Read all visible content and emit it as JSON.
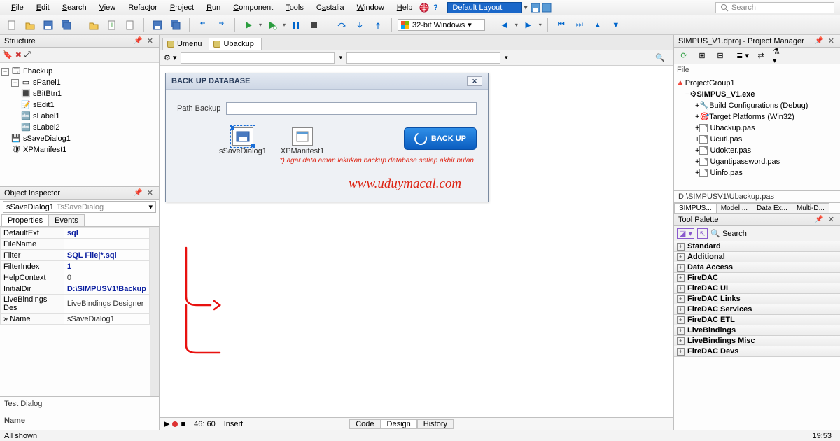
{
  "menu": {
    "items": [
      "File",
      "Edit",
      "Search",
      "View",
      "Refactor",
      "Project",
      "Run",
      "Component",
      "Tools",
      "Castalia",
      "Window",
      "Help"
    ],
    "layout": "Default Layout",
    "search_placeholder": "Search"
  },
  "toolbar": {
    "platform": "32-bit Windows"
  },
  "structure": {
    "title": "Structure",
    "root": "Fbackup",
    "panel": "sPanel1",
    "children": [
      "sBitBtn1",
      "sEdit1",
      "sLabel1",
      "sLabel2"
    ],
    "extra": [
      "sSaveDialog1",
      "XPManifest1"
    ]
  },
  "inspector": {
    "title": "Object Inspector",
    "component_name": "sSaveDialog1",
    "component_type": "TsSaveDialog",
    "tabs": [
      "Properties",
      "Events"
    ],
    "rows": [
      {
        "k": "DefaultExt",
        "v": "sql",
        "bold": true
      },
      {
        "k": "FileName",
        "v": "",
        "bold": true
      },
      {
        "k": "Filter",
        "v": "SQL File|*.sql",
        "bold": true
      },
      {
        "k": "FilterIndex",
        "v": "1",
        "bold": true
      },
      {
        "k": "HelpContext",
        "v": "0",
        "bold": false
      },
      {
        "k": "InitialDir",
        "v": "D:\\SIMPUSV1\\Backup",
        "bold": true
      },
      {
        "k": "LiveBindings Des",
        "v": "LiveBindings Designer",
        "bold": false
      },
      {
        "k": "Name",
        "v": "sSaveDialog1",
        "bold": false
      }
    ],
    "test_dialog": "Test Dialog",
    "name_label": "Name",
    "all_shown": "All shown"
  },
  "center": {
    "tabs": [
      {
        "label": "Umenu",
        "active": false
      },
      {
        "label": "Ubackup",
        "active": true
      }
    ],
    "form": {
      "title": "BACK UP DATABASE",
      "path_label": "Path Backup",
      "comp1": "sSaveDialog1",
      "comp2": "XPManifest1",
      "button": "BACK UP",
      "note": "*) agar data aman lakukan backup database setiap akhir bulan"
    },
    "watermark": "www.uduymacal.com",
    "status": {
      "cursor": "46: 60",
      "mode": "Insert",
      "tabs": [
        "Code",
        "Design",
        "History"
      ],
      "active_tab": "Design"
    }
  },
  "project": {
    "title_full": "SIMPUS_V1.dproj - Project Manager",
    "file_label": "File",
    "group": "ProjectGroup1",
    "exe": "SIMPUS_V1.exe",
    "build": "Build Configurations (Debug)",
    "target": "Target Platforms (Win32)",
    "files": [
      "Ubackup.pas",
      "Ucuti.pas",
      "Udokter.pas",
      "Ugantipassword.pas",
      "Uinfo.pas"
    ],
    "path": "D:\\SIMPUSV1\\Ubackup.pas",
    "tabs": [
      "SIMPUS...",
      "Model ...",
      "Data Ex...",
      "Multi-D..."
    ]
  },
  "palette": {
    "title": "Tool Palette",
    "search_placeholder": "Search",
    "cats": [
      "Standard",
      "Additional",
      "Data Access",
      "FireDAC",
      "FireDAC UI",
      "FireDAC Links",
      "FireDAC Services",
      "FireDAC ETL",
      "LiveBindings",
      "LiveBindings Misc",
      "FireDAC Devs"
    ]
  },
  "clock": "19:53"
}
